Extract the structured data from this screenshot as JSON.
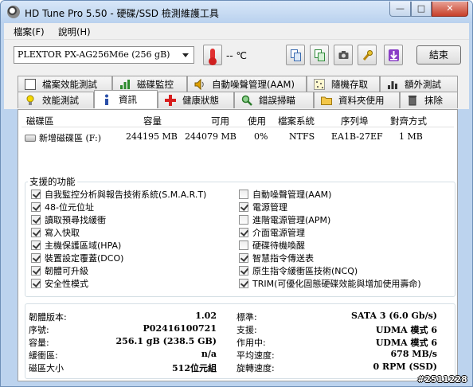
{
  "window": {
    "title": "HD Tune Pro 5.50 - 硬碟/SSD 檢測維護工具",
    "min_label": "—",
    "max_label": "□",
    "close_label": "✕"
  },
  "menu": [
    {
      "label": "檔案(F)"
    },
    {
      "label": "說明(H)"
    }
  ],
  "toolbar": {
    "drive": "PLEXTOR PX-AG256M6e (256 gB)",
    "temperature": "-- ℃",
    "exit_label": "結束"
  },
  "tabs_top": [
    {
      "label": "檔案效能測試",
      "icon": "file-benchmark-icon"
    },
    {
      "label": "磁碟監控",
      "icon": "disk-monitor-icon"
    },
    {
      "label": "自動噪聲管理(AAM)",
      "icon": "speaker-icon"
    },
    {
      "label": "隨機存取",
      "icon": "random-access-icon"
    },
    {
      "label": "額外測試",
      "icon": "extra-tests-icon"
    }
  ],
  "tabs_bottom": [
    {
      "label": "效能測試",
      "icon": "lightbulb-icon"
    },
    {
      "label": "資訊",
      "icon": "info-icon"
    },
    {
      "label": "健康狀態",
      "icon": "health-cross-icon"
    },
    {
      "label": "錯誤掃瞄",
      "icon": "magnifier-icon"
    },
    {
      "label": "資料夾使用",
      "icon": "folder-icon"
    },
    {
      "label": "抹除",
      "icon": "trash-icon"
    }
  ],
  "active_tab": "資訊",
  "partition_table": {
    "headers": [
      "磁碟區",
      "容量",
      "可用",
      "使用",
      "檔案系統",
      "序列埠",
      "對齊方式"
    ],
    "rows": [
      [
        "新增磁碟區 (F:)",
        "244195 MB",
        "244079 MB",
        "0%",
        "NTFS",
        "EA1B-27EF",
        "1 MB"
      ]
    ]
  },
  "features": {
    "title": "支援的功能",
    "left": [
      {
        "label": "自我監控分析與報告技術系統(S.M.A.R.T)",
        "checked": true
      },
      {
        "label": "48-位元位址",
        "checked": true
      },
      {
        "label": "讀取預尋找緩衝",
        "checked": true
      },
      {
        "label": "寫入快取",
        "checked": true
      },
      {
        "label": "主機保護區域(HPA)",
        "checked": true
      },
      {
        "label": "裝置設定覆蓋(DCO)",
        "checked": true
      },
      {
        "label": "韌體可升級",
        "checked": true
      },
      {
        "label": "安全性模式",
        "checked": true
      }
    ],
    "right": [
      {
        "label": "自動噪聲管理(AAM)",
        "checked": false
      },
      {
        "label": "電源管理",
        "checked": true
      },
      {
        "label": "進階電源管理(APM)",
        "checked": false
      },
      {
        "label": "介面電源管理",
        "checked": true
      },
      {
        "label": "硬碟待機喚醒",
        "checked": false
      },
      {
        "label": "智慧指令傳送表",
        "checked": true
      },
      {
        "label": "原生指令緩衝區技術(NCQ)",
        "checked": true
      },
      {
        "label": "TRIM(可優化固態硬碟效能與增加使用壽命)",
        "checked": true
      }
    ]
  },
  "info_left": [
    {
      "key": "韌體版本:",
      "value": "1.02"
    },
    {
      "key": "序號:",
      "value": "P02416100721"
    },
    {
      "key": "容量:",
      "value": "256.1 gB (238.5 GB)"
    },
    {
      "key": "緩衝區:",
      "value": "n/a"
    },
    {
      "key": "磁區大小",
      "value": "512位元組"
    }
  ],
  "info_right": [
    {
      "key": "標準:",
      "value": "SATA 3 (6.0 Gb/s)"
    },
    {
      "key": "支援:",
      "value": "UDMA 模式 6"
    },
    {
      "key": "作用中:",
      "value": "UDMA 模式 6"
    },
    {
      "key": "平均速度:",
      "value": "678 MB/s"
    },
    {
      "key": "旋轉速度:",
      "value": "0 RPM (SSD)"
    }
  ],
  "watermark": "#2511228"
}
